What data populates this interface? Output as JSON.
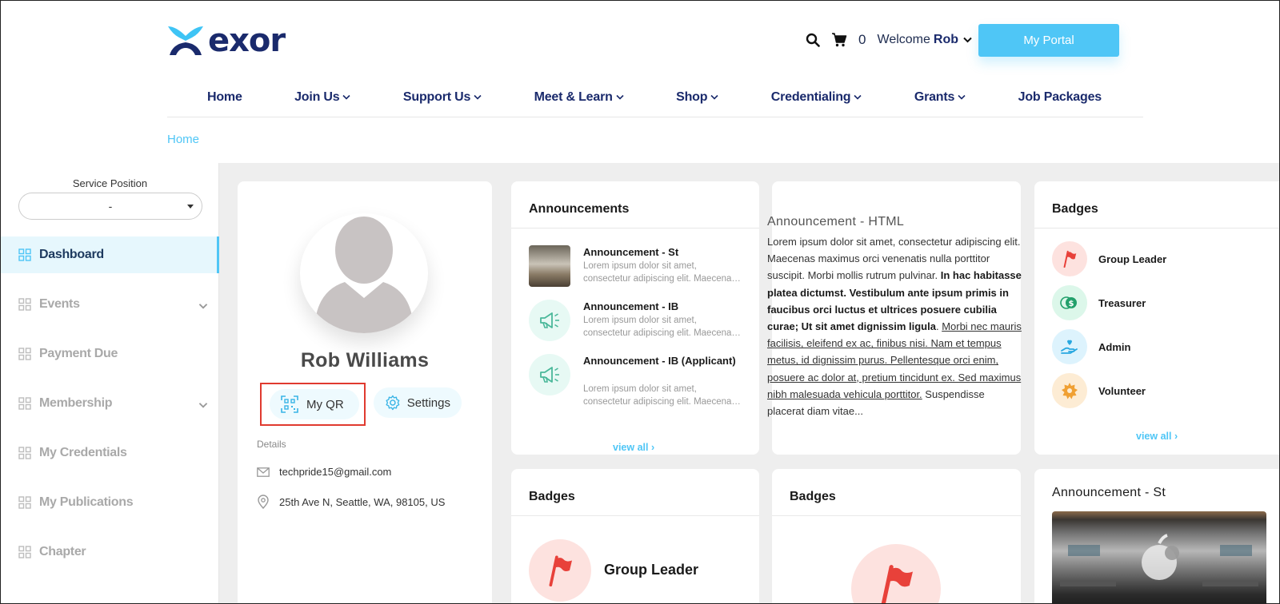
{
  "header": {
    "logo_text": "exor",
    "cart_count": "0",
    "welcome": "Welcome",
    "user_name": "Rob",
    "portal_button": "My Portal"
  },
  "nav": [
    {
      "label": "Home",
      "dropdown": false
    },
    {
      "label": "Join Us",
      "dropdown": true
    },
    {
      "label": "Support Us",
      "dropdown": true
    },
    {
      "label": "Meet & Learn",
      "dropdown": true
    },
    {
      "label": "Shop",
      "dropdown": true
    },
    {
      "label": "Credentialing",
      "dropdown": true
    },
    {
      "label": "Grants",
      "dropdown": true
    },
    {
      "label": "Job Packages",
      "dropdown": false
    }
  ],
  "breadcrumb": "Home",
  "sidebar": {
    "service_position_label": "Service Position",
    "service_position_value": "-",
    "items": [
      {
        "label": "Dashboard",
        "active": true,
        "expandable": false
      },
      {
        "label": "Events",
        "active": false,
        "expandable": true
      },
      {
        "label": "Payment Due",
        "active": false,
        "expandable": false
      },
      {
        "label": "Membership",
        "active": false,
        "expandable": true
      },
      {
        "label": "My Credentials",
        "active": false,
        "expandable": false
      },
      {
        "label": "My Publications",
        "active": false,
        "expandable": false
      },
      {
        "label": "Chapter",
        "active": false,
        "expandable": false
      }
    ]
  },
  "profile": {
    "name": "Rob Williams",
    "my_qr": "My QR",
    "settings": "Settings",
    "details_label": "Details",
    "email": "techpride15@gmail.com",
    "address": "25th Ave N, Seattle, WA, 98105, US"
  },
  "announcements": {
    "title": "Announcements",
    "items": [
      {
        "title": "Announcement - St",
        "desc1": "Lorem ipsum dolor sit amet,",
        "desc2": "consectetur adipiscing elit. Maecenas maximus",
        "thumb": "photo"
      },
      {
        "title": "Announcement - IB",
        "desc1": "Lorem ipsum dolor sit amet,",
        "desc2": "consectetur adipiscing elit. Maecenas maximus",
        "thumb": "megaphone-icon"
      },
      {
        "title": "Announcement - IB (Applicant)",
        "desc1": "Lorem ipsum dolor sit amet,",
        "desc2": "consectetur adipiscing elit. Maecenas maximus",
        "thumb": "megaphone-icon"
      }
    ],
    "view_all": "view all ›"
  },
  "html_announcement": {
    "title": "Announcement - HTML",
    "text_plain_1": "Lorem ipsum dolor sit amet, consectetur adipiscing elit. Maecenas maximus orci venenatis nulla porttitor suscipit. Morbi mollis rutrum pulvinar. ",
    "text_bold": "In hac habitasse platea dictumst. Vestibulum ante ipsum primis in faucibus orci luctus et ultrices posuere cubilia curae; Ut sit amet dignissim ligula",
    "text_plain_2": ". ",
    "text_underline": "Morbi nec mauris facilisis, eleifend ex ac, finibus nisi. Nam et tempus metus, id dignissim purus. Pellentesque orci enim, posuere ac dolor at, pretium tincidunt ex. Sed maximus nibh malesuada vehicula porttitor.",
    "text_plain_3": " Suspendisse placerat diam vitae..."
  },
  "badges_card": {
    "title": "Badges",
    "items": [
      {
        "label": "Group Leader",
        "icon": "flag-icon",
        "bg": "#fde2df",
        "color": "#e8413a"
      },
      {
        "label": "Treasurer",
        "icon": "money-icon",
        "bg": "#dcf7ea",
        "color": "#22a06b"
      },
      {
        "label": "Admin",
        "icon": "hand-heart-icon",
        "bg": "#ddf3fd",
        "color": "#29a8e0"
      },
      {
        "label": "Volunteer",
        "icon": "sun-gear-icon",
        "bg": "#fdecd4",
        "color": "#f0a033"
      }
    ],
    "view_all": "view all ›"
  },
  "badges_card_2": {
    "title": "Badges",
    "label": "Group Leader"
  },
  "badges_card_3": {
    "title": "Badges"
  },
  "announcement_st_card": {
    "title": "Announcement - St"
  },
  "colors": {
    "accent": "#4fc6f6",
    "navy": "#1a2a6c",
    "highlight": "#e03a2f"
  }
}
